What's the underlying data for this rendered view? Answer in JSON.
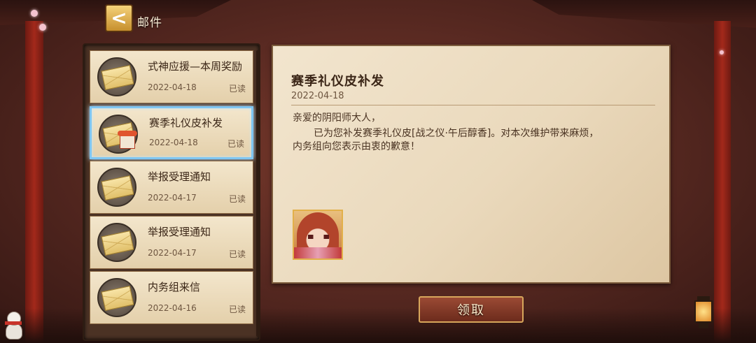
{
  "header": {
    "back_icon": "chevron-left-icon",
    "back_glyph": "<",
    "title": "邮件"
  },
  "mail_list": [
    {
      "subject": "式神应援—本周奖励",
      "date": "2022-04-18",
      "status": "已读",
      "icon": "envelope-icon",
      "selected": false
    },
    {
      "subject": "赛季礼仪皮补发",
      "date": "2022-04-18",
      "status": "已读",
      "icon": "envelope-gift-icon",
      "selected": true
    },
    {
      "subject": "举报受理通知",
      "date": "2022-04-17",
      "status": "已读",
      "icon": "envelope-icon",
      "selected": false
    },
    {
      "subject": "举报受理通知",
      "date": "2022-04-17",
      "status": "已读",
      "icon": "envelope-icon",
      "selected": false
    },
    {
      "subject": "内务组来信",
      "date": "2022-04-16",
      "status": "已读",
      "icon": "envelope-icon",
      "selected": false
    }
  ],
  "detail": {
    "title": "赛季礼仪皮补发",
    "date": "2022-04-18",
    "greeting": "亲爱的阴阳师大人，",
    "body_lines": [
      "已为您补发赛季礼仪皮[战之仪·午后醇香]。对本次维护带来麻烦，",
      "内务组向您表示由衷的歉意！"
    ],
    "reward_icon": "character-portrait-icon"
  },
  "actions": {
    "claim_label": "领取"
  },
  "colors": {
    "selected_border": "#7fc6f2",
    "claim_button": "#8a3d2a",
    "paper": "#efe1c8"
  }
}
